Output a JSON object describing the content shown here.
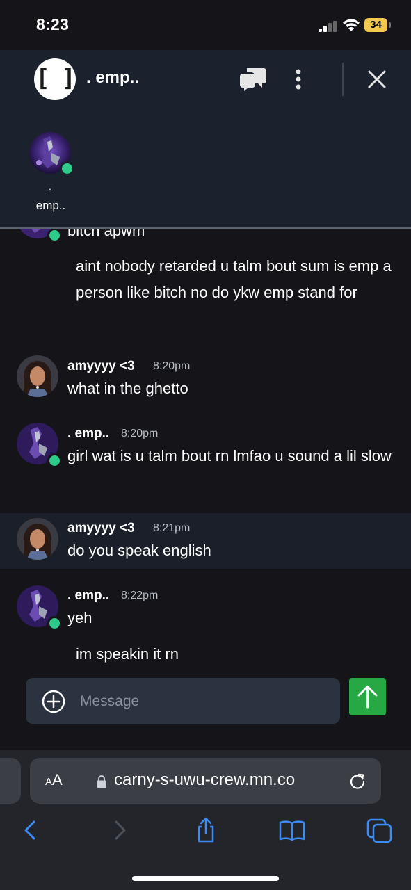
{
  "status_bar": {
    "time": "8:23",
    "battery_level": "34",
    "battery_color": "#f2c94c"
  },
  "header": {
    "group_icon_text": "[ ]",
    "title": ". emp..",
    "icons": [
      "chat-bubbles-icon",
      "more-vertical-icon",
      "close-icon"
    ],
    "member": {
      "dot": ".",
      "name": "emp.."
    }
  },
  "messages": {
    "partial_top_text": "bitch apwm",
    "continuation_1": "aint nobody retarded u talm bout sum is emp a person like bitch no do ykw emp stand for",
    "items": [
      {
        "author": "amyyyy <3",
        "time": "8:20pm",
        "text": "what in the ghetto"
      },
      {
        "author": ". emp..",
        "time": "8:20pm",
        "text": "girl wat is u talm bout rn lmfao u sound a lil slow"
      },
      {
        "author": "amyyyy <3",
        "time": "8:21pm",
        "text": "do you speak english"
      },
      {
        "author": ". emp..",
        "time": "8:22pm",
        "text": "yeh"
      }
    ],
    "continuation_2": "im speakin it rn"
  },
  "composer": {
    "placeholder": "Message",
    "send_color": "#28a745"
  },
  "browser": {
    "aa_label_small": "A",
    "aa_label_large": "A",
    "url": "carny-s-uwu-crew.mn.co",
    "toolbar_icons": [
      "back-icon",
      "forward-icon",
      "share-icon",
      "bookmarks-icon",
      "tabs-icon"
    ]
  }
}
